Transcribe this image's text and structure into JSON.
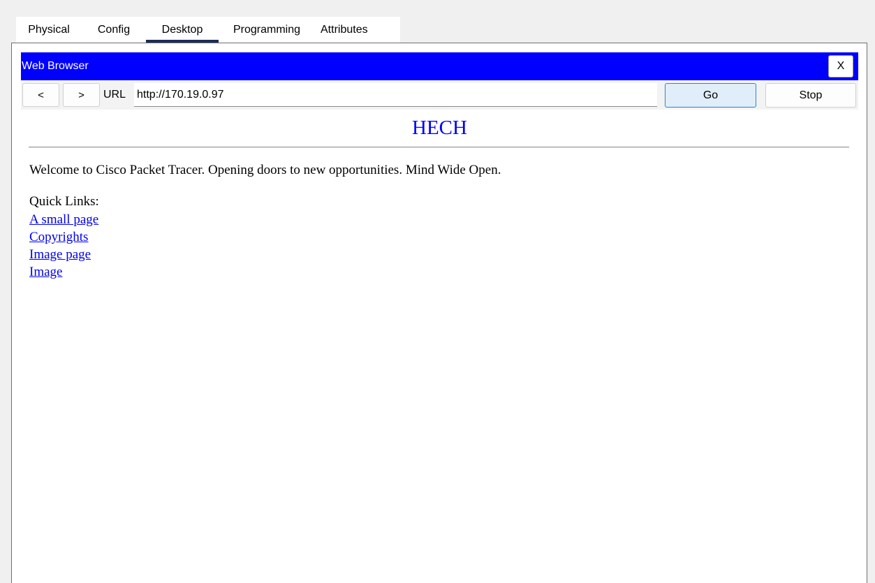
{
  "tabs": [
    {
      "label": "Physical",
      "active": false
    },
    {
      "label": "Config",
      "active": false
    },
    {
      "label": "Desktop",
      "active": true
    },
    {
      "label": "Programming",
      "active": false
    },
    {
      "label": "Attributes",
      "active": false
    }
  ],
  "window": {
    "title": "Web Browser",
    "close_label": "X",
    "title_color": "#0000ff"
  },
  "nav": {
    "back_label": "<",
    "forward_label": ">",
    "url_label": "URL",
    "url_value": "http://170.19.0.97",
    "go_label": "Go",
    "stop_label": "Stop"
  },
  "page": {
    "heading": "HECH",
    "welcome": "Welcome to Cisco Packet Tracer. Opening doors to new opportunities. Mind Wide Open.",
    "quick_links_label": "Quick Links:",
    "links": [
      "A small page",
      "Copyrights",
      "Image page",
      "Image"
    ]
  }
}
